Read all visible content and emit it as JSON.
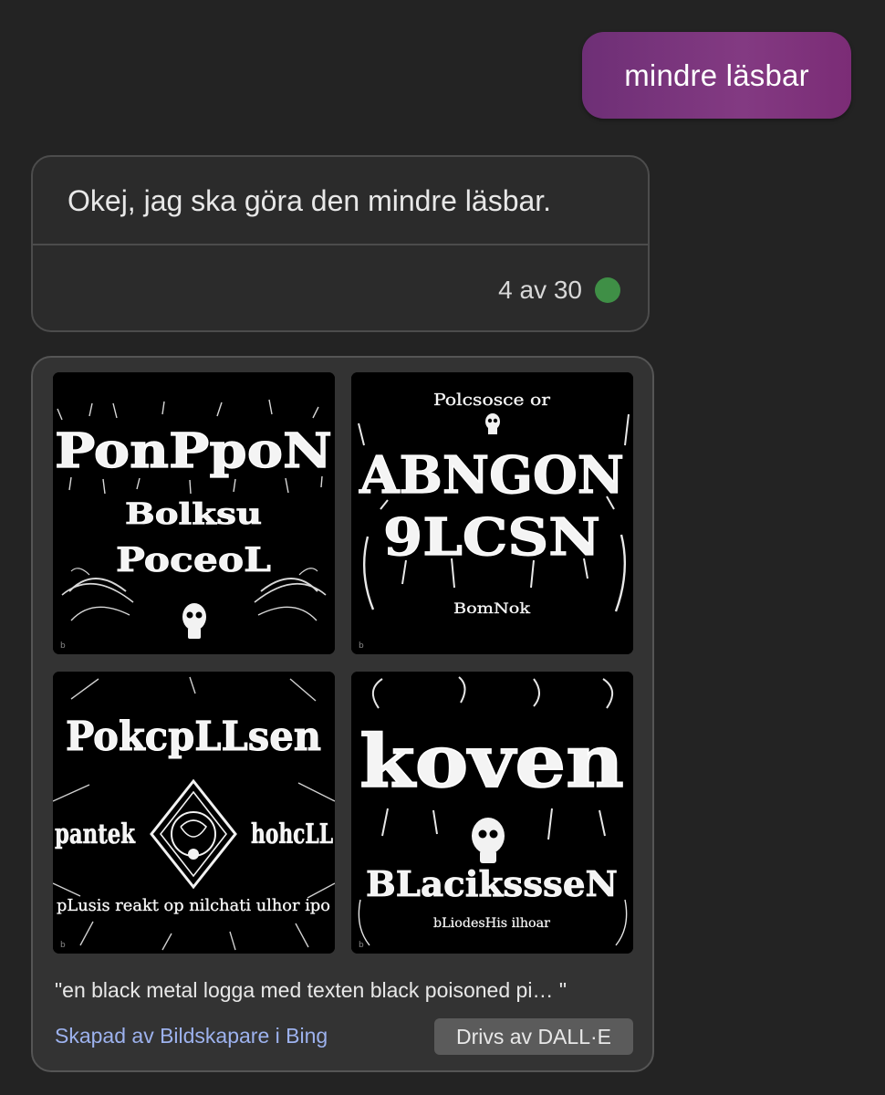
{
  "user_message": {
    "text": "mindre läsbar"
  },
  "bot_message": {
    "text": "Okej, jag ska göra den mindre läsbar.",
    "turn_counter": "4 av 30",
    "status_color": "#3f8f46"
  },
  "image_card": {
    "images": [
      {
        "lines": [
          "PonPpoN",
          "Bolksu",
          "PoceoL"
        ]
      },
      {
        "lines": [
          "Polcsosce or",
          "ABNGON",
          "9LCSN",
          "BomNok"
        ]
      },
      {
        "lines": [
          "PokcpLLsen",
          "pantek",
          "hohcLL",
          "pLusis reakt op nilchati ulhor ipo"
        ]
      },
      {
        "lines": [
          "koven",
          "BLacikssseN",
          "bLiodesHis ilhoar"
        ]
      }
    ],
    "prompt": "\"en black metal logga med texten black poisoned pi… \"",
    "creator_link": "Skapad av Bildskapare i Bing",
    "powered_by": "Drivs av DALL·E"
  }
}
